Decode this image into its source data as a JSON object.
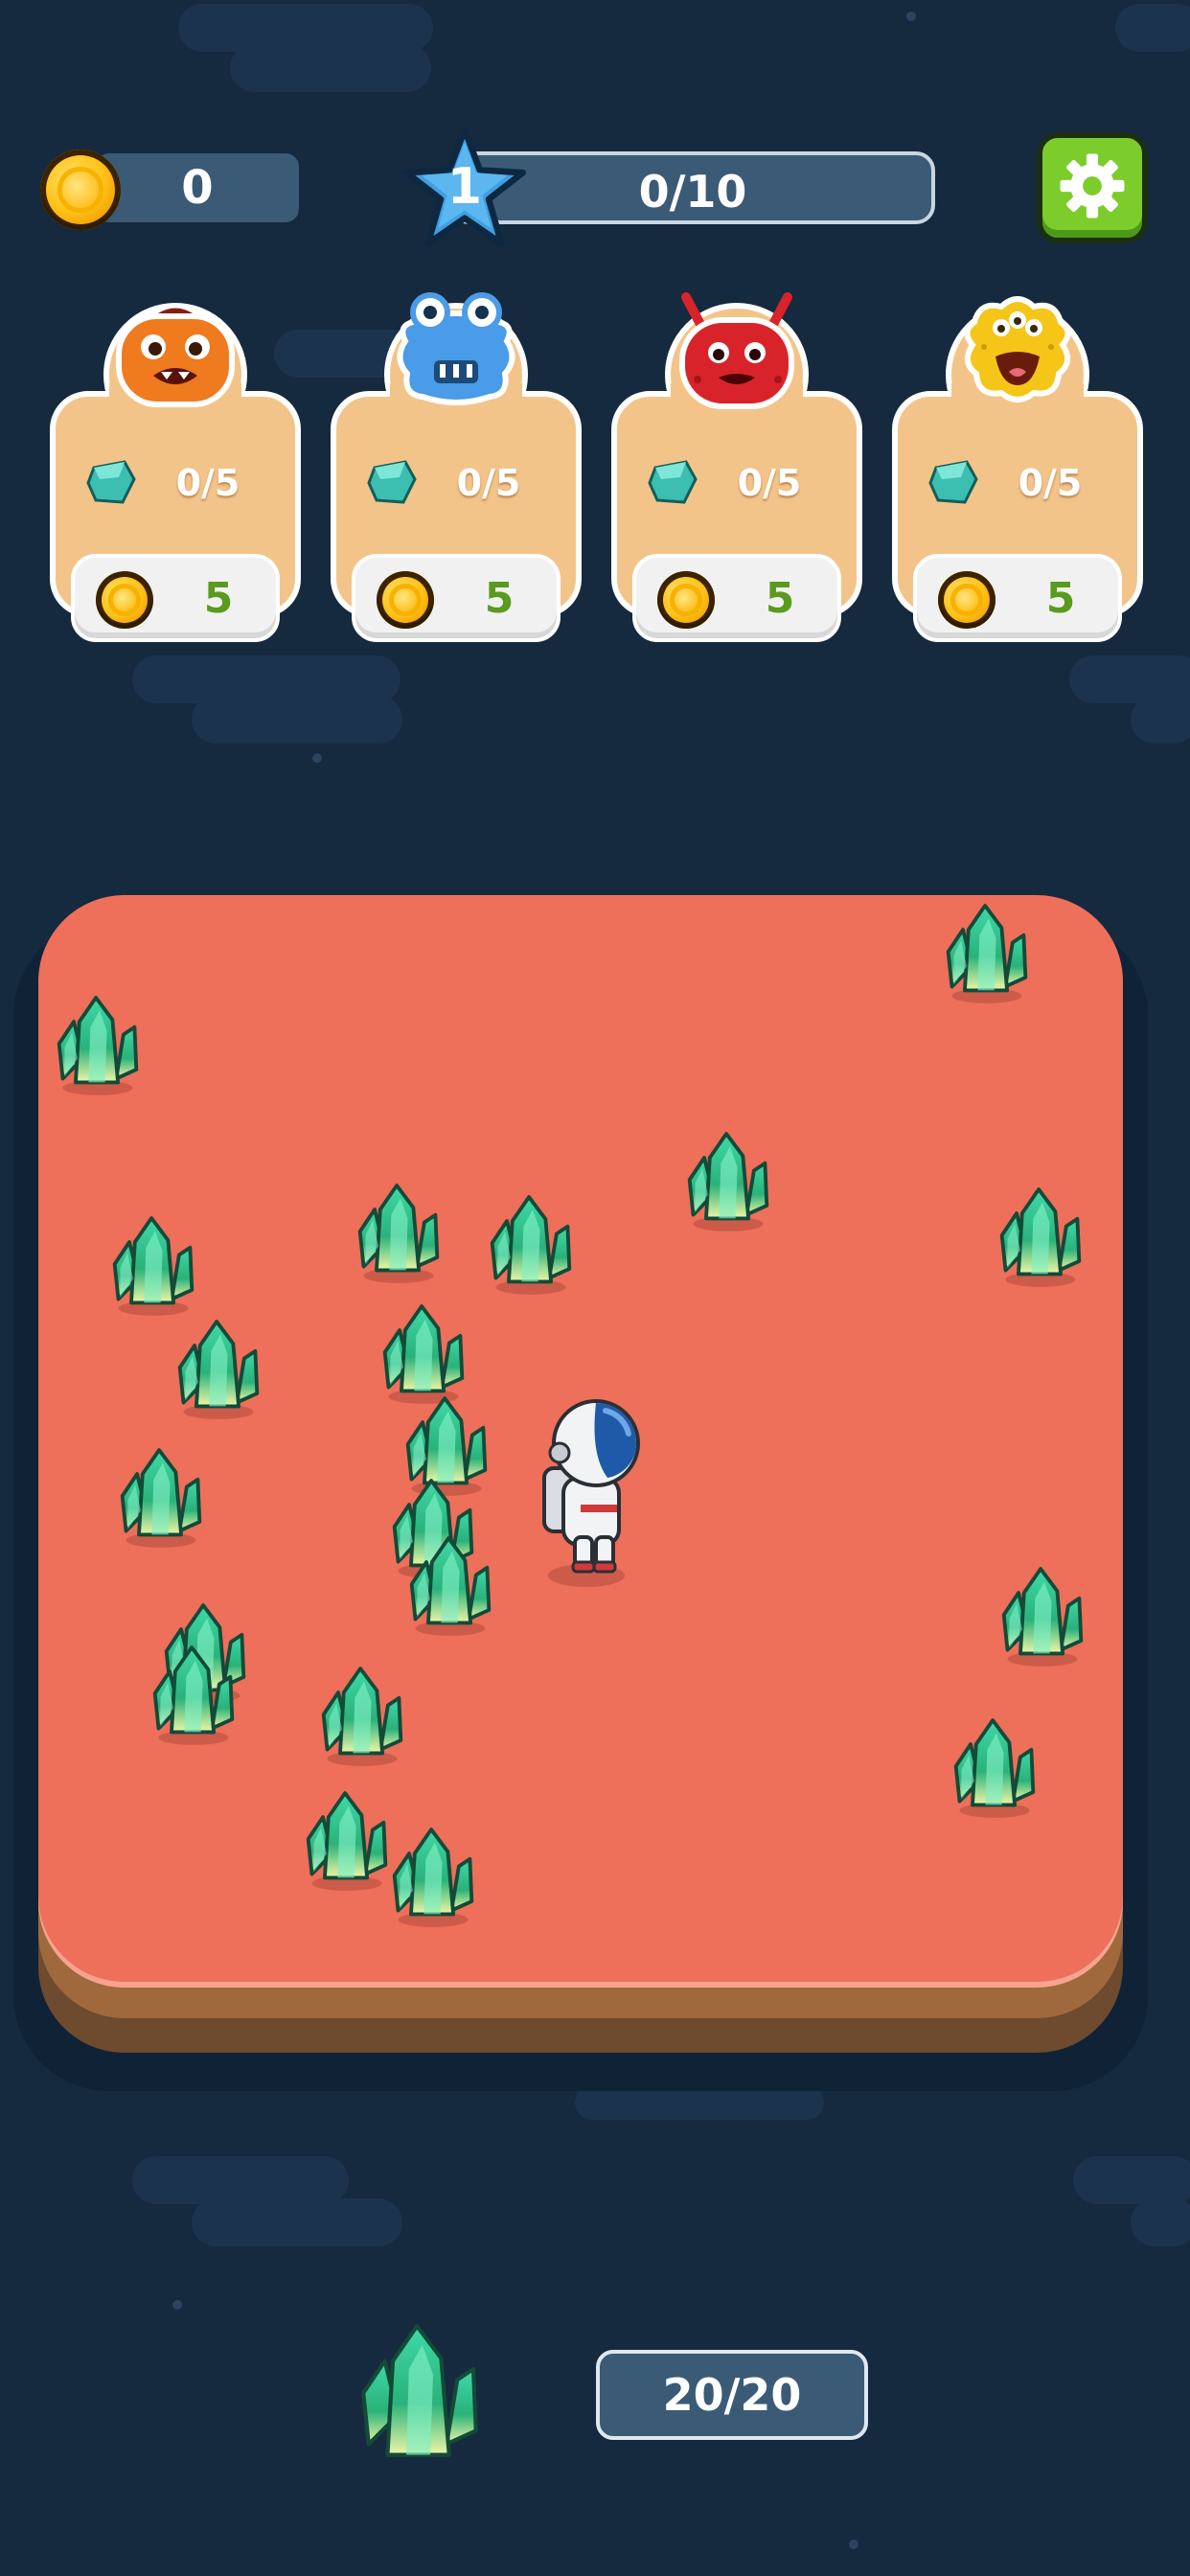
{
  "hud": {
    "coins": "0",
    "level": "1",
    "level_progress": "0/10"
  },
  "monsters": [
    {
      "name": "orange-monster",
      "color": "#f07a1e",
      "gems": "0/5",
      "price": "5"
    },
    {
      "name": "blue-monster",
      "color": "#4a9be8",
      "gems": "0/5",
      "price": "5"
    },
    {
      "name": "red-monster",
      "color": "#d8232a",
      "gems": "0/5",
      "price": "5"
    },
    {
      "name": "yellow-monster",
      "color": "#f5c518",
      "gems": "0/5",
      "price": "5"
    }
  ],
  "inventory": {
    "item_icon": "green-crystal-icon",
    "capacity": "20/20"
  },
  "colors": {
    "background": "#15293f",
    "ground": "#ee6f5a",
    "settings_button": "#7ccd2b"
  }
}
